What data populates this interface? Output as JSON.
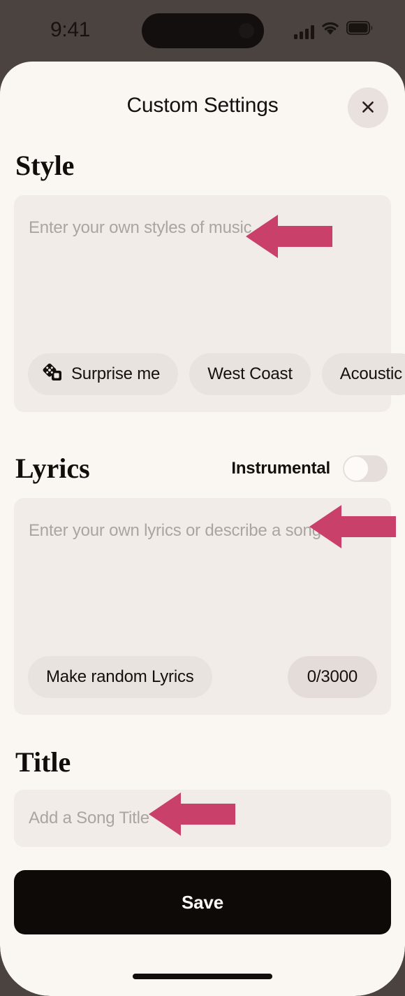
{
  "status_bar": {
    "time": "9:41",
    "signal_icon": "cellular-signal-icon",
    "wifi_icon": "wifi-icon",
    "battery_icon": "battery-icon"
  },
  "header": {
    "title": "Custom Settings",
    "close_label": "×"
  },
  "style": {
    "heading": "Style",
    "placeholder": "Enter your own styles of music",
    "value": "",
    "chips": [
      {
        "label": "Surprise me",
        "icon": "dice-icon"
      },
      {
        "label": "West Coast",
        "icon": ""
      },
      {
        "label": "Acoustic",
        "icon": ""
      }
    ]
  },
  "lyrics": {
    "heading": "Lyrics",
    "instrumental_label": "Instrumental",
    "instrumental_on": false,
    "placeholder": "Enter your own lyrics or describe a song...",
    "value": "",
    "random_button_label": "Make random Lyrics",
    "counter": "0/3000"
  },
  "title": {
    "heading": "Title",
    "placeholder": "Add a Song Title",
    "value": ""
  },
  "save": {
    "label": "Save"
  },
  "annotations": [
    {
      "name": "arrow-pointing-to-style-field",
      "direction": "left"
    },
    {
      "name": "arrow-pointing-to-lyrics-field",
      "direction": "left"
    },
    {
      "name": "arrow-pointing-to-title-field",
      "direction": "left"
    }
  ],
  "colors": {
    "accent_arrow": "#c9406a",
    "sheet_background": "#faf6f2",
    "card_background": "#f2ece8",
    "chip_background": "#e9e3df",
    "save_background": "#0e0a08",
    "frame": "#4a4340"
  }
}
